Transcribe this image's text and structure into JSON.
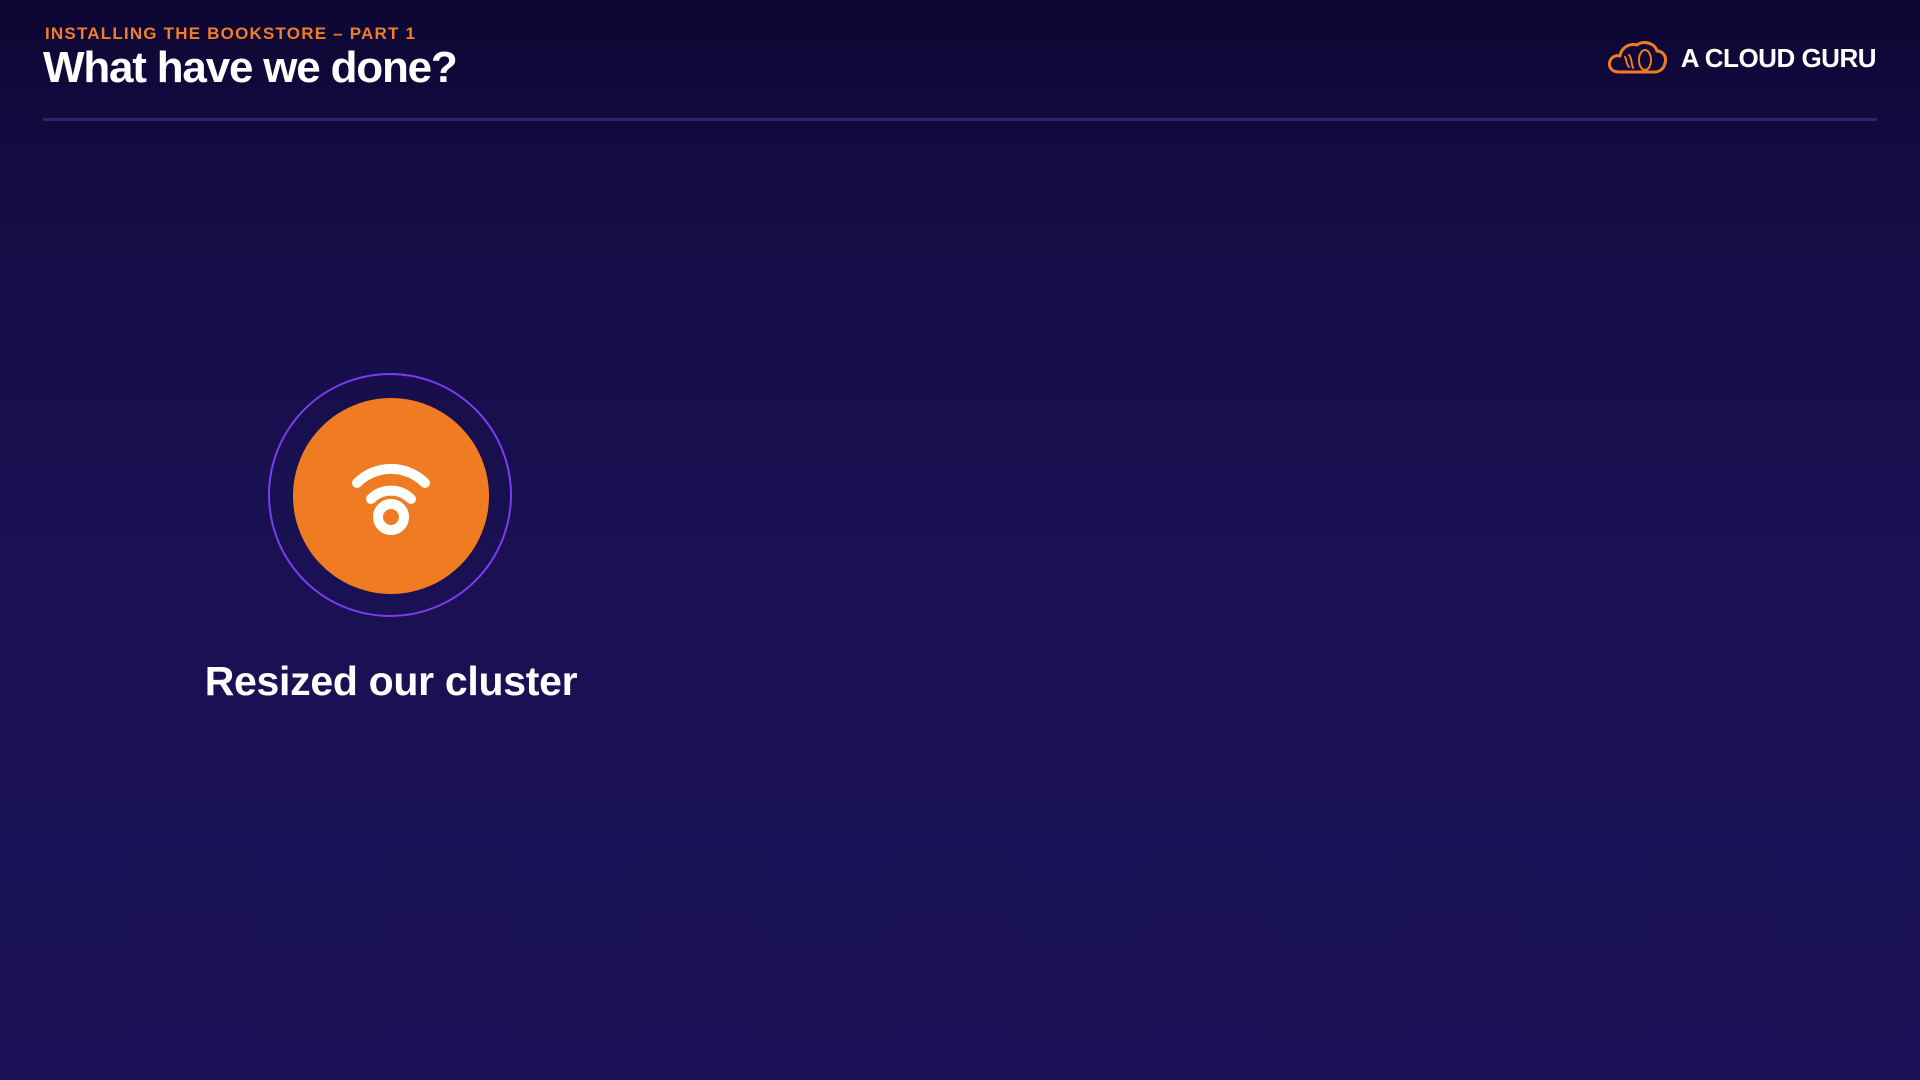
{
  "header": {
    "eyebrow": "INSTALLING THE BOOKSTORE – PART 1",
    "title": "What have we done?"
  },
  "brand": {
    "logo_icon": "cloud-guru-logo-icon",
    "name": "A CLOUD GURU"
  },
  "items": [
    {
      "icon": "wifi-icon",
      "label": "Resized our cluster"
    }
  ],
  "colors": {
    "background": "#1a1154",
    "accent": "#ef7c22",
    "ring": "#7b3df0",
    "text": "#ffffff"
  }
}
